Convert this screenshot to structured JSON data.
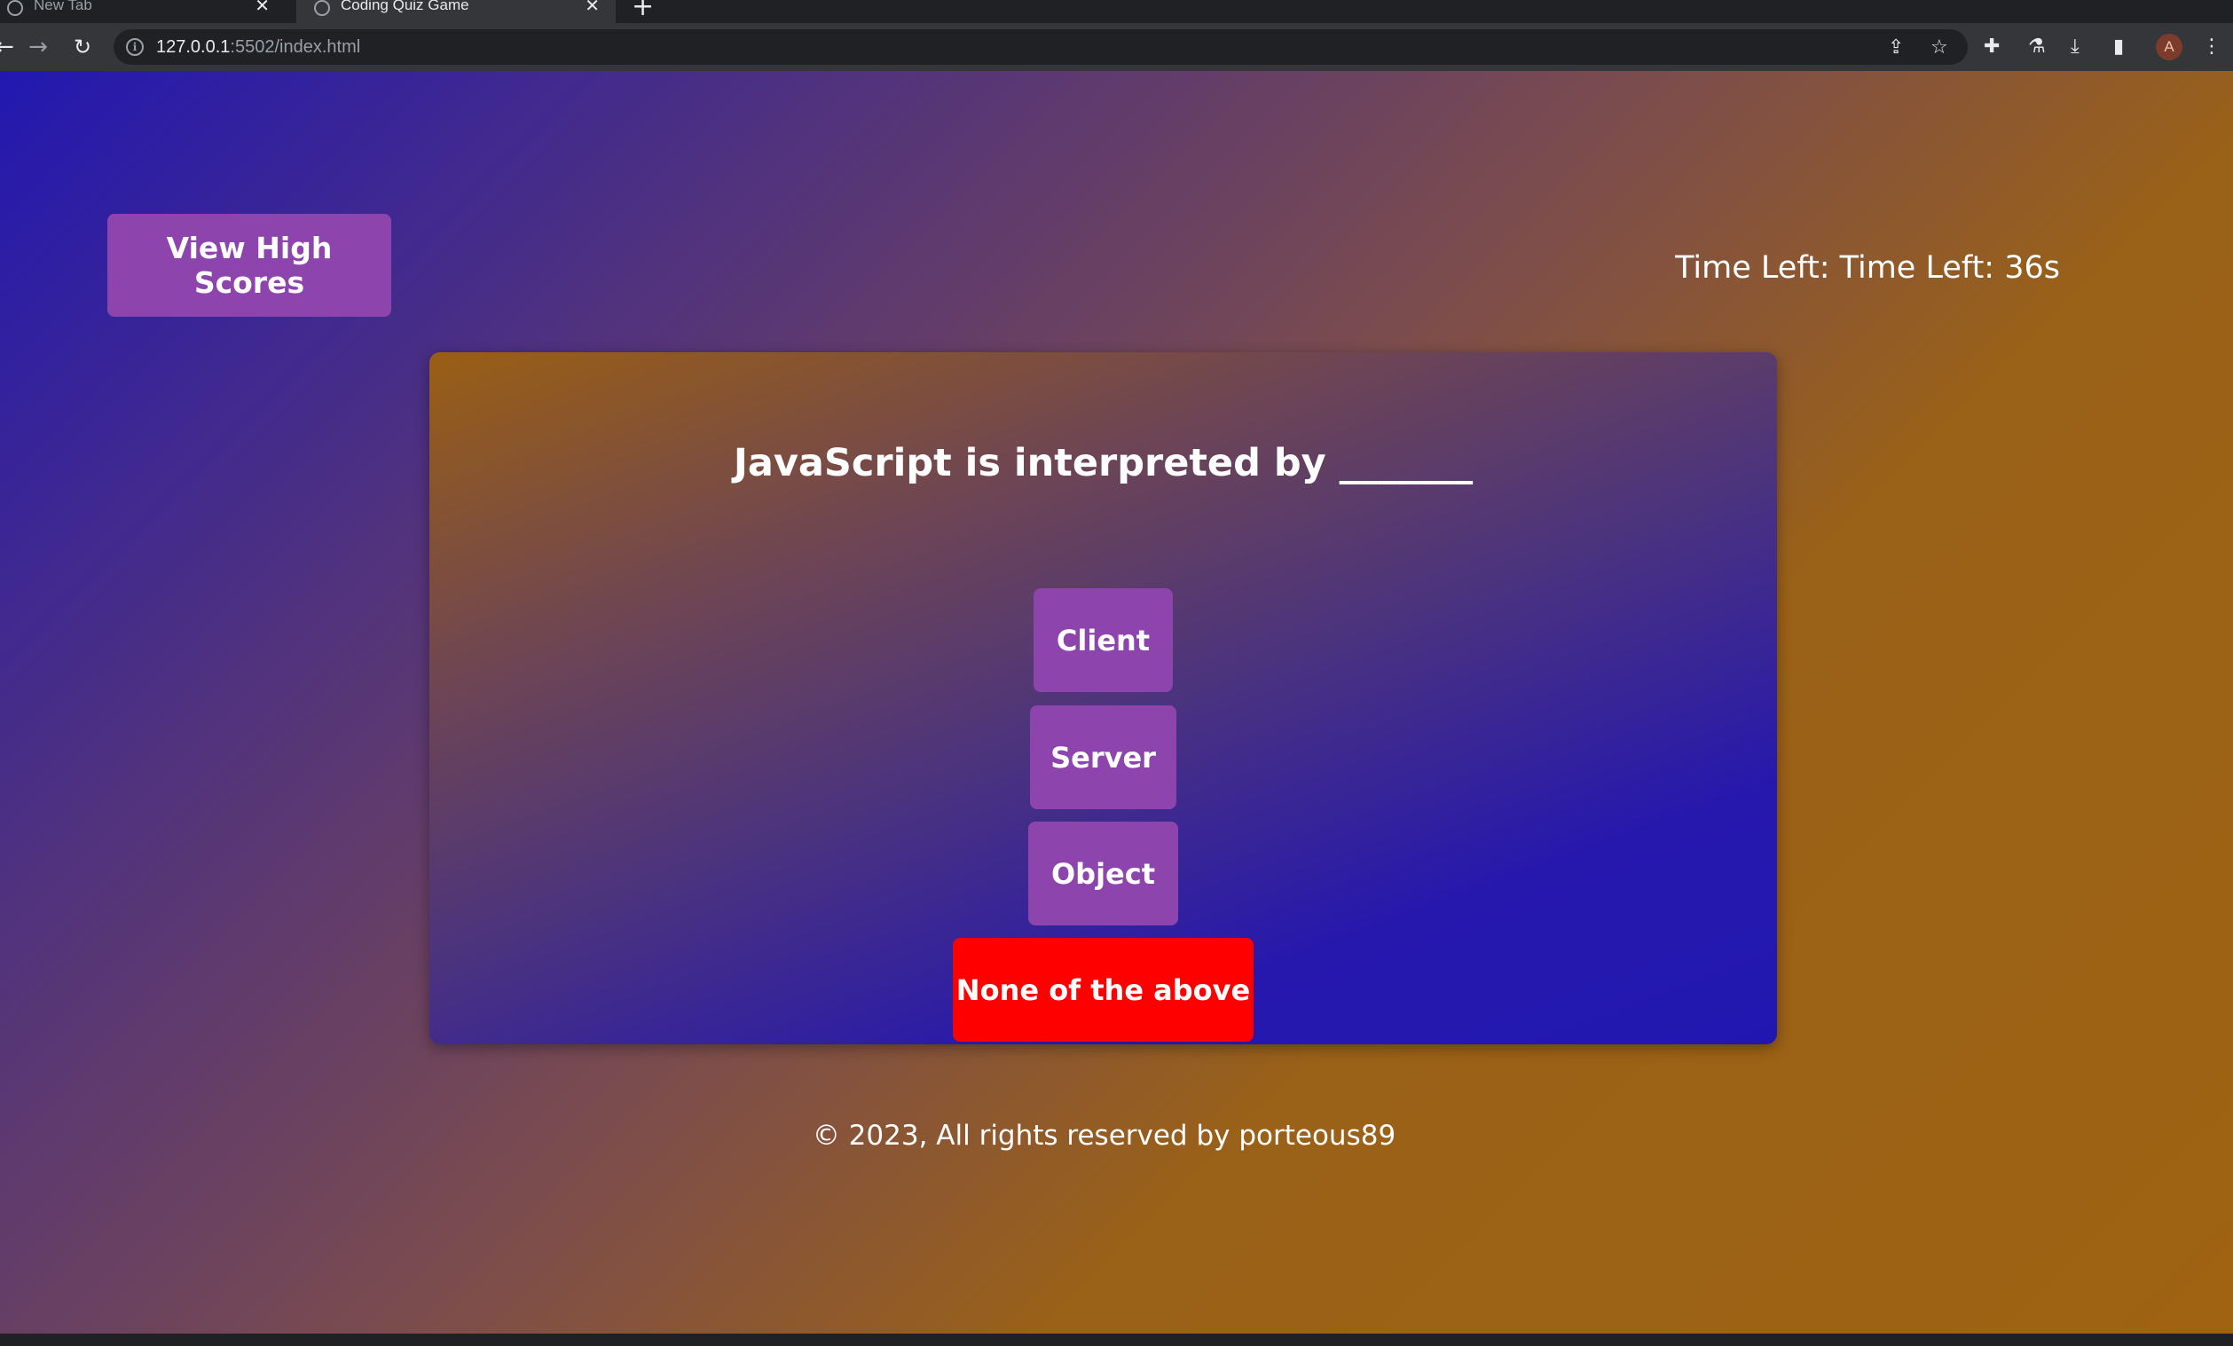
{
  "browser": {
    "tabs": [
      {
        "title": "New Tab",
        "active": false
      },
      {
        "title": "Coding Quiz Game",
        "active": true
      }
    ],
    "url_host": "127.0.0.1",
    "url_rest": ":5502/index.html",
    "profile_initial": "A"
  },
  "page": {
    "high_scores_label": "View High Scores",
    "timer_text": "Time Left: Time Left: 36s",
    "question": "JavaScript is interpreted by _______",
    "answers": [
      {
        "label": "Client",
        "state": "default"
      },
      {
        "label": "Server",
        "state": "default"
      },
      {
        "label": "Object",
        "state": "default"
      },
      {
        "label": "None of the above",
        "state": "selected"
      }
    ],
    "footer": "© 2023, All rights reserved by porteous89"
  },
  "colors": {
    "button": "#8e44ad",
    "selected_answer": "#ff0000",
    "gradient_blue": "#2218b0",
    "gradient_orange": "#9f6312"
  }
}
